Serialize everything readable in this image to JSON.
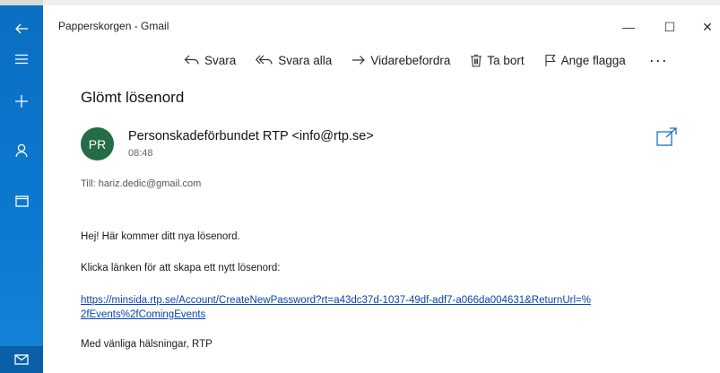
{
  "window": {
    "title": "Papperskorgen - Gmail",
    "controls": [
      "—",
      "☐",
      "✕"
    ]
  },
  "toolbar": {
    "reply": "Svara",
    "reply_all": "Svara alla",
    "forward": "Vidarebefordra",
    "delete": "Ta bort",
    "flag": "Ange flagga",
    "more": "···"
  },
  "message": {
    "subject": "Glömt lösenord",
    "avatar_initials": "PR",
    "avatar_color": "#236c46",
    "sender": "Personskadeförbundet RTP <info@rtp.se>",
    "time": "08:48",
    "to_label": "Till:",
    "to_address": "hariz.dedic@gmail.com",
    "body": {
      "greeting": "Hej! Här kommer ditt nya lösenord.",
      "instruction": "Klicka länken för att skapa ett nytt lösenord:",
      "link_line1": "https://minsida.rtp.se/Account/CreateNewPassword?rt=a43dc37d-1037-49df-adf7-a066da004631&ReturnUrl=%",
      "link_line2": "2fEvents%2fComingEvents",
      "signoff": "Med vänliga hälsningar, RTP"
    }
  },
  "rail": {
    "accent": "#0b78cf",
    "icons": [
      "back-arrow-icon",
      "hamburger-menu-icon",
      "new-mail-plus-icon",
      "person-icon",
      "calendar-icon",
      "mail-icon"
    ]
  }
}
